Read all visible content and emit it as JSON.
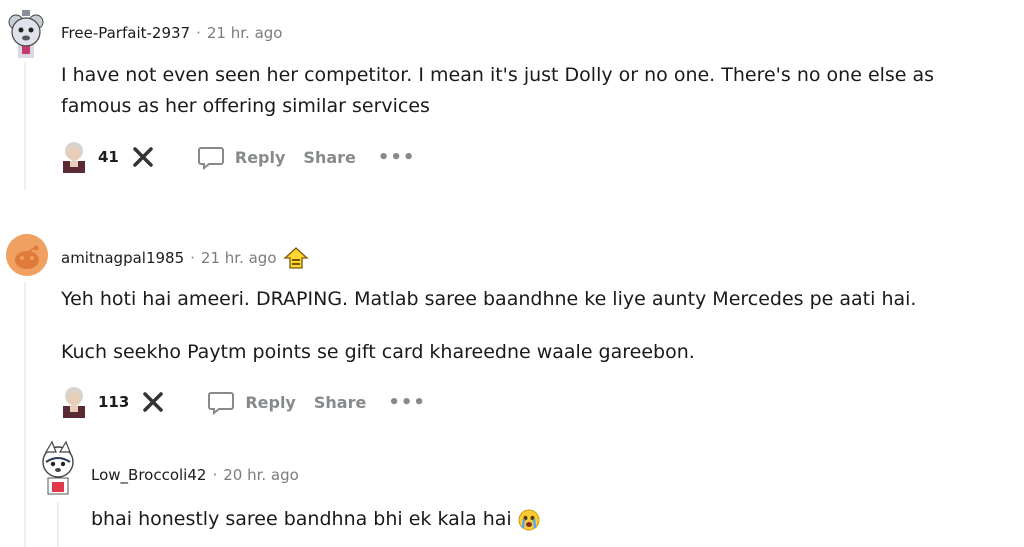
{
  "comments": [
    {
      "author": "Free-Parfait-2937",
      "separator": "·",
      "time": "21 hr. ago",
      "paragraphs": [
        "I have not even seen her competitor. I mean it's just Dolly or no one. There's no one else as famous as her offering similar services"
      ],
      "score": "41",
      "reply_label": "Reply",
      "share_label": "Share",
      "more_label": "•••"
    },
    {
      "author": "amitnagpal1985",
      "separator": "·",
      "time": "21 hr. ago",
      "award_icon": "helpful-award-icon",
      "paragraphs": [
        "Yeh hoti hai ameeri. DRAPING. Matlab saree baandhne ke liye aunty Mercedes pe aati hai.",
        "Kuch seekho Paytm points se gift card khareedne waale gareebon."
      ],
      "score": "113",
      "reply_label": "Reply",
      "share_label": "Share",
      "more_label": "•••"
    },
    {
      "author": "Low_Broccoli42",
      "separator": "·",
      "time": "20 hr. ago",
      "paragraphs": [
        "bhai honestly saree bandhna bhi ek kala hai"
      ],
      "emoji_icon": "crying-face-icon"
    }
  ],
  "colors": {
    "meta_gray": "#7c7c7c",
    "action_gray": "#878a8c",
    "thread_line": "#edeff1",
    "orange_avatar": "#f0a060"
  }
}
